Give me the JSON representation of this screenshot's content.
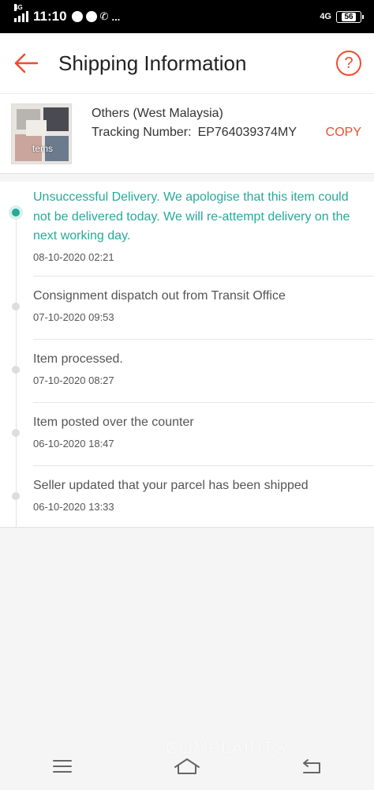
{
  "status_bar": {
    "time": "11:10",
    "network_type": "4G",
    "network_type_right": "4G",
    "battery": "56",
    "more": "..."
  },
  "header": {
    "title": "Shipping Information",
    "help_symbol": "?"
  },
  "shipment": {
    "thumbnail_text": "tems",
    "method": "Others (West Malaysia)",
    "tracking_label": "Tracking Number:",
    "tracking_number": "EP764039374MY",
    "copy_label": "COPY"
  },
  "timeline": [
    {
      "description": "Unsuccessful Delivery. We apologise that this item could not be delivered today. We will re-attempt delivery on the next working day.",
      "time": "08-10-2020 02:21",
      "active": true
    },
    {
      "description": "Consignment dispatch out from Transit Office",
      "time": "07-10-2020 09:53",
      "active": false
    },
    {
      "description": "Item processed.",
      "time": "07-10-2020 08:27",
      "active": false
    },
    {
      "description": "Item posted over the counter",
      "time": "06-10-2020 18:47",
      "active": false
    },
    {
      "description": "Seller updated that your parcel has been shipped",
      "time": "06-10-2020 13:33",
      "active": false
    }
  ],
  "colors": {
    "accent": "#ee4d2d",
    "active_status": "#26aa99"
  },
  "watermark": "COMPLAINTS"
}
